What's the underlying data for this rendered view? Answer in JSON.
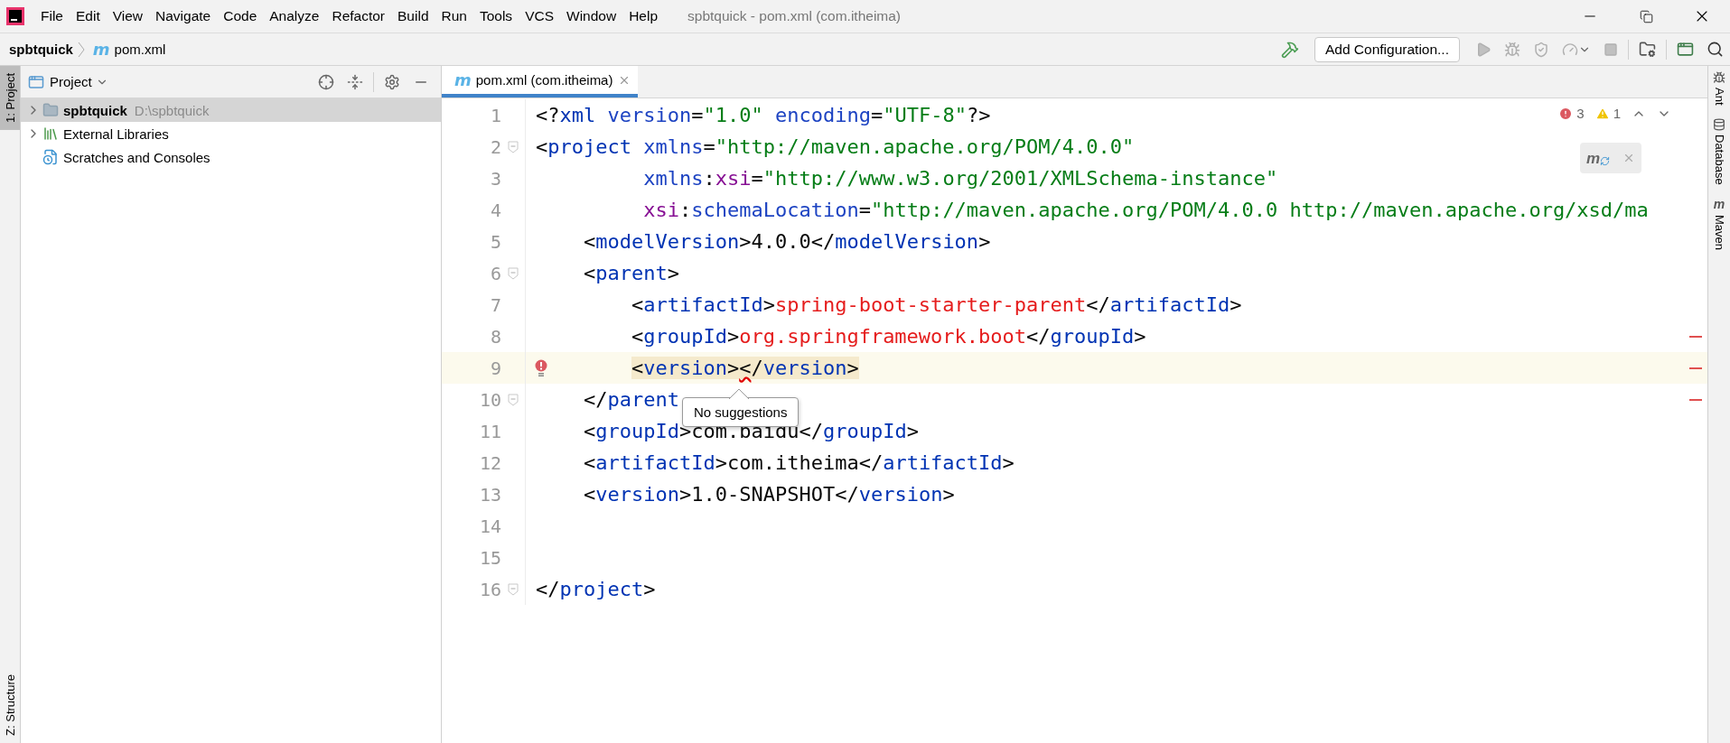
{
  "window": {
    "title": "spbtquick - pom.xml (com.itheima)"
  },
  "menu": [
    "File",
    "Edit",
    "View",
    "Navigate",
    "Code",
    "Analyze",
    "Refactor",
    "Build",
    "Run",
    "Tools",
    "VCS",
    "Window",
    "Help"
  ],
  "breadcrumb": [
    {
      "label": "spbtquick"
    },
    {
      "icon": "m",
      "label": "pom.xml"
    }
  ],
  "toolbar": {
    "run_config": "Add Configuration..."
  },
  "left_strip": [
    {
      "label": "1: Project",
      "selected": true,
      "kind": "top"
    },
    {
      "label": "Z: Structure",
      "selected": false,
      "kind": "bottom"
    }
  ],
  "project_panel": {
    "title": "Project",
    "tree": [
      {
        "label": "spbtquick",
        "path": "D:\\spbtquick",
        "kind": "module",
        "selected": true,
        "expandable": true
      },
      {
        "label": "External Libraries",
        "kind": "libraries",
        "selected": false,
        "expandable": true
      },
      {
        "label": "Scratches and Consoles",
        "kind": "scratches",
        "selected": false
      }
    ]
  },
  "editor": {
    "tabs": [
      {
        "icon": "m",
        "label": "pom.xml (com.itheima)",
        "selected": true
      }
    ],
    "inspections": {
      "errors": "3",
      "warnings": "1"
    },
    "maven_popup": {
      "icon": "m"
    },
    "tooltip": "No suggestions",
    "lines": [
      {
        "number": "1",
        "tokens": [
          {
            "kind": "p",
            "text": "<?"
          },
          {
            "kind": "tag",
            "text": "xml"
          },
          {
            "kind": "attr",
            "text": " version"
          },
          {
            "kind": "p",
            "text": "="
          },
          {
            "kind": "val",
            "text": "\"1.0\""
          },
          {
            "kind": "attr",
            "text": " encoding"
          },
          {
            "kind": "p",
            "text": "="
          },
          {
            "kind": "val",
            "text": "\"UTF-8\""
          },
          {
            "kind": "p",
            "text": "?>"
          }
        ]
      },
      {
        "number": "2",
        "fold": true,
        "tokens": [
          {
            "kind": "p",
            "text": "<"
          },
          {
            "kind": "tag",
            "text": "project"
          },
          {
            "kind": "attr",
            "text": " xmlns"
          },
          {
            "kind": "p",
            "text": "="
          },
          {
            "kind": "val",
            "text": "\"http://maven.apache.org/POM/4.0.0\""
          }
        ]
      },
      {
        "number": "3",
        "tokens": [
          {
            "kind": "attr",
            "text": "         xmlns"
          },
          {
            "kind": "p",
            "text": ":"
          },
          {
            "kind": "ns",
            "text": "xsi"
          },
          {
            "kind": "p",
            "text": "="
          },
          {
            "kind": "val",
            "text": "\"http://www.w3.org/2001/XMLSchema-instance\""
          }
        ]
      },
      {
        "number": "4",
        "tokens": [
          {
            "kind": "ns",
            "text": "         xsi"
          },
          {
            "kind": "p",
            "text": ":"
          },
          {
            "kind": "attr",
            "text": "schemaLocation"
          },
          {
            "kind": "p",
            "text": "="
          },
          {
            "kind": "val",
            "text": "\"http://maven.apache.org/POM/4.0.0 http://maven.apache.org/xsd/ma"
          }
        ]
      },
      {
        "number": "5",
        "tokens": [
          {
            "kind": "p",
            "text": "    <"
          },
          {
            "kind": "tag",
            "text": "modelVersion"
          },
          {
            "kind": "p",
            "text": ">"
          },
          {
            "kind": "text",
            "text": "4.0.0"
          },
          {
            "kind": "p",
            "text": "</"
          },
          {
            "kind": "tag",
            "text": "modelVersion"
          },
          {
            "kind": "p",
            "text": ">"
          }
        ]
      },
      {
        "number": "6",
        "fold": true,
        "tokens": [
          {
            "kind": "p",
            "text": "    <"
          },
          {
            "kind": "tag",
            "text": "parent"
          },
          {
            "kind": "p",
            "text": ">"
          }
        ]
      },
      {
        "number": "7",
        "tokens": [
          {
            "kind": "p",
            "text": "        <"
          },
          {
            "kind": "tag",
            "text": "artifactId"
          },
          {
            "kind": "p",
            "text": ">"
          },
          {
            "kind": "err",
            "text": "spring-boot-starter-parent"
          },
          {
            "kind": "p",
            "text": "</"
          },
          {
            "kind": "tag",
            "text": "artifactId"
          },
          {
            "kind": "p",
            "text": ">"
          }
        ]
      },
      {
        "number": "8",
        "stripe_error": true,
        "tokens": [
          {
            "kind": "p",
            "text": "        <"
          },
          {
            "kind": "tag",
            "text": "groupId"
          },
          {
            "kind": "p",
            "text": ">"
          },
          {
            "kind": "err",
            "text": "org.springframework.boot"
          },
          {
            "kind": "p",
            "text": "</"
          },
          {
            "kind": "tag",
            "text": "groupId"
          },
          {
            "kind": "p",
            "text": ">"
          }
        ]
      },
      {
        "number": "9",
        "current": true,
        "highlighted": true,
        "error_bulb": true,
        "stripe_error": true,
        "tokens": [
          {
            "kind": "p",
            "text": "        <"
          },
          {
            "kind": "tag",
            "text": "version"
          },
          {
            "kind": "p",
            "text": ">"
          },
          {
            "kind": "p",
            "text": "<",
            "squiggle": true
          },
          {
            "kind": "p",
            "text": "/"
          },
          {
            "kind": "tag",
            "text": "version"
          },
          {
            "kind": "p",
            "text": ">"
          }
        ]
      },
      {
        "number": "10",
        "fold": true,
        "stripe_error": true,
        "tokens": [
          {
            "kind": "p",
            "text": "    </"
          },
          {
            "kind": "tag",
            "text": "parent"
          }
        ]
      },
      {
        "number": "11",
        "tokens": [
          {
            "kind": "p",
            "text": "    <"
          },
          {
            "kind": "tag",
            "text": "groupId"
          },
          {
            "kind": "p",
            "text": ">"
          },
          {
            "kind": "text",
            "text": "com.baidu"
          },
          {
            "kind": "p",
            "text": "</"
          },
          {
            "kind": "tag",
            "text": "groupId"
          },
          {
            "kind": "p",
            "text": ">"
          }
        ]
      },
      {
        "number": "12",
        "tokens": [
          {
            "kind": "p",
            "text": "    <"
          },
          {
            "kind": "tag",
            "text": "artifactId"
          },
          {
            "kind": "p",
            "text": ">"
          },
          {
            "kind": "text",
            "text": "com.itheima"
          },
          {
            "kind": "p",
            "text": "</"
          },
          {
            "kind": "tag",
            "text": "artifactId"
          },
          {
            "kind": "p",
            "text": ">"
          }
        ]
      },
      {
        "number": "13",
        "tokens": [
          {
            "kind": "p",
            "text": "    <"
          },
          {
            "kind": "tag",
            "text": "version"
          },
          {
            "kind": "p",
            "text": ">"
          },
          {
            "kind": "text",
            "text": "1.0-SNAPSHOT"
          },
          {
            "kind": "p",
            "text": "</"
          },
          {
            "kind": "tag",
            "text": "version"
          },
          {
            "kind": "p",
            "text": ">"
          }
        ]
      },
      {
        "number": "14"
      },
      {
        "number": "15"
      },
      {
        "number": "16",
        "fold": true,
        "tokens": [
          {
            "kind": "p",
            "text": "</"
          },
          {
            "kind": "tag",
            "text": "project"
          },
          {
            "kind": "p",
            "text": ">"
          }
        ]
      }
    ]
  },
  "right_strip": [
    {
      "label": "Ant",
      "kind": "ant"
    },
    {
      "label": "Database",
      "kind": "database"
    },
    {
      "label": "Maven",
      "kind": "maven",
      "icon": "m"
    }
  ]
}
